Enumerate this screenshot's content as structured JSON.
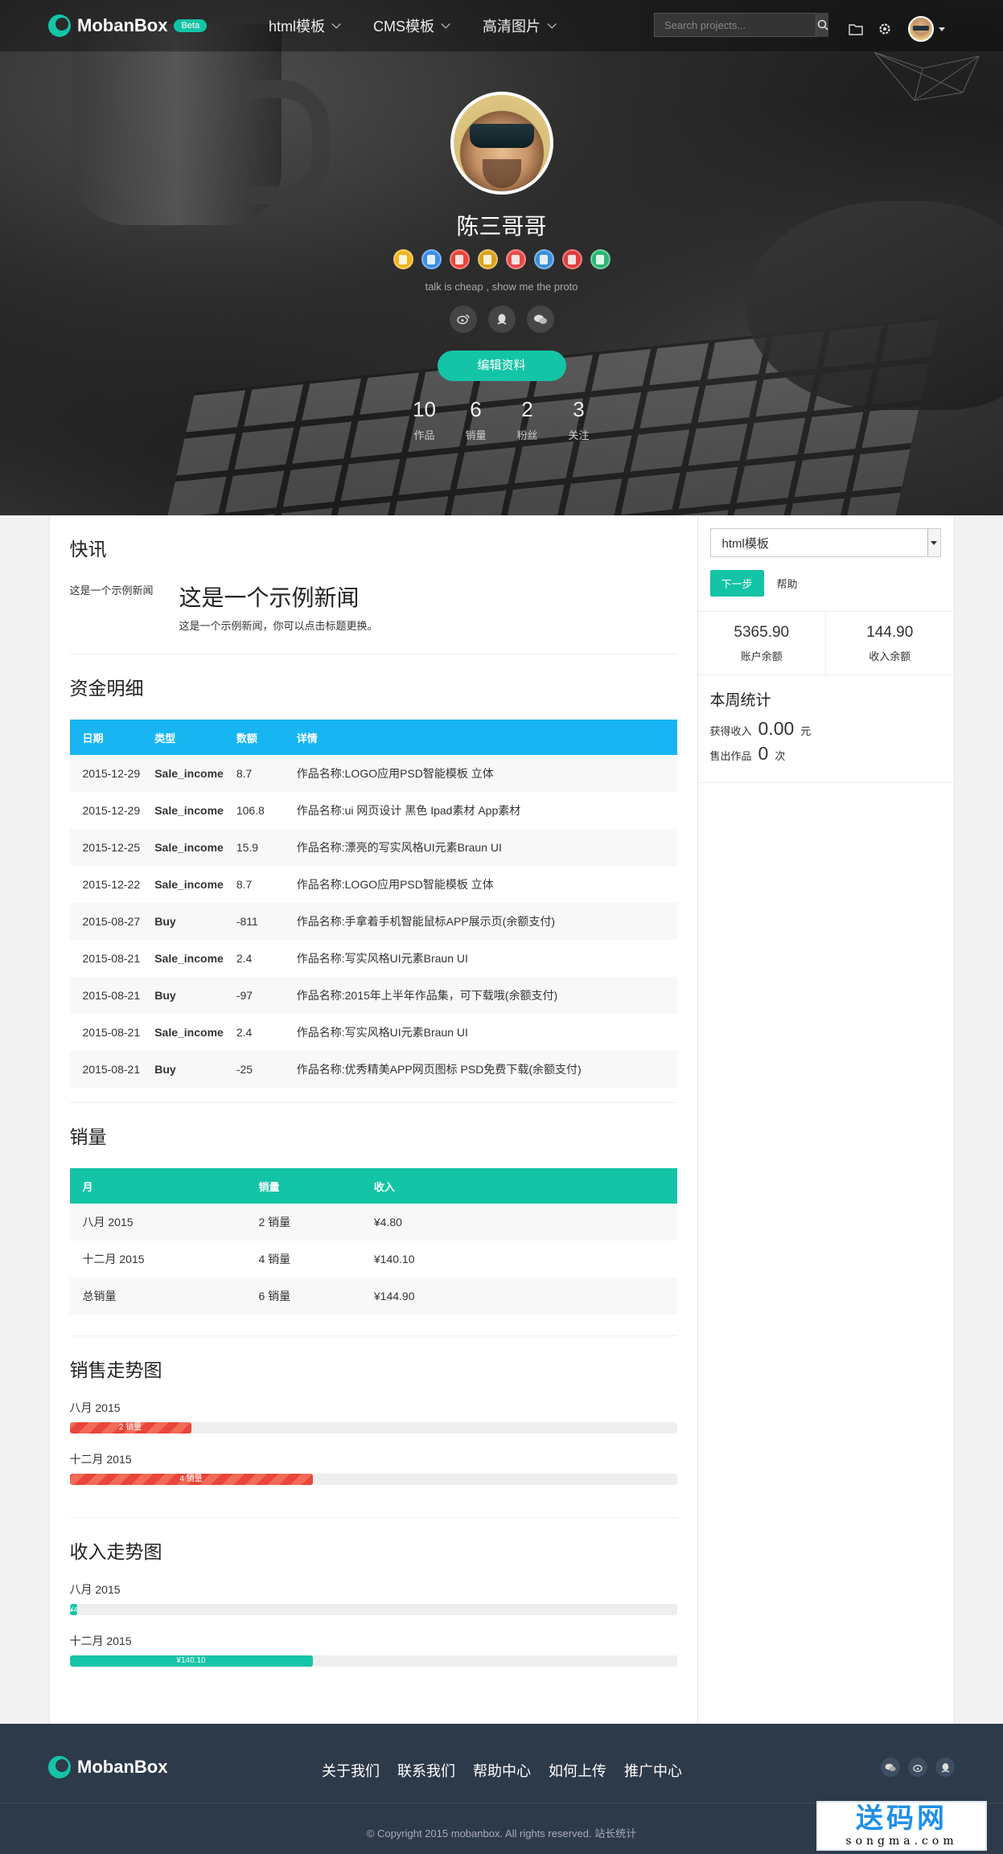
{
  "brand": {
    "name": "MobanBox",
    "beta": "Beta"
  },
  "nav": [
    {
      "label": "html模板"
    },
    {
      "label": "CMS模板"
    },
    {
      "label": "高清图片"
    }
  ],
  "search": {
    "placeholder": "Search projects..."
  },
  "profile": {
    "name": "陈三哥哥",
    "motto": "talk is cheap , show me the proto",
    "edit_label": "编辑资料",
    "badges": [
      {
        "icon": "badge-yellow-doc",
        "color": "#f2b51c"
      },
      {
        "icon": "badge-blue-doc",
        "color": "#3b8ee8"
      },
      {
        "icon": "badge-red-doc",
        "color": "#e8453a"
      },
      {
        "icon": "badge-gold-ticket",
        "color": "#d9a21a"
      },
      {
        "icon": "badge-lifebuoy",
        "color": "#e84a4a"
      },
      {
        "icon": "badge-blue-shield",
        "color": "#3a8fd9"
      },
      {
        "icon": "badge-red-gear",
        "color": "#e23c3c"
      },
      {
        "icon": "badge-green-list",
        "color": "#2bb673"
      }
    ],
    "stats": [
      {
        "value": "10",
        "label": "作品"
      },
      {
        "value": "6",
        "label": "销量"
      },
      {
        "value": "2",
        "label": "粉丝"
      },
      {
        "value": "3",
        "label": "关注"
      }
    ]
  },
  "news": {
    "heading": "快讯",
    "tag": "这是一个示例新闻",
    "title": "这是一个示例新闻",
    "desc": "这是一个示例新闻，你可以点击标题更换。"
  },
  "funds": {
    "heading": "资金明细",
    "columns": [
      "日期",
      "类型",
      "数额",
      "详情"
    ],
    "rows": [
      [
        "2015-12-29",
        "Sale_income",
        "8.7",
        "作品名称:LOGO应用PSD智能模板 立体"
      ],
      [
        "2015-12-29",
        "Sale_income",
        "106.8",
        "作品名称:ui 网页设计 黑色 Ipad素材 App素材"
      ],
      [
        "2015-12-25",
        "Sale_income",
        "15.9",
        "作品名称:漂亮的写实风格UI元素Braun UI"
      ],
      [
        "2015-12-22",
        "Sale_income",
        "8.7",
        "作品名称:LOGO应用PSD智能模板 立体"
      ],
      [
        "2015-08-27",
        "Buy",
        "-811",
        "作品名称:手拿着手机智能鼠标APP展示页(余额支付)"
      ],
      [
        "2015-08-21",
        "Sale_income",
        "2.4",
        "作品名称:写实风格UI元素Braun UI"
      ],
      [
        "2015-08-21",
        "Buy",
        "-97",
        "作品名称:2015年上半年作品集，可下载哦(余额支付)"
      ],
      [
        "2015-08-21",
        "Sale_income",
        "2.4",
        "作品名称:写实风格UI元素Braun UI"
      ],
      [
        "2015-08-21",
        "Buy",
        "-25",
        "作品名称:优秀精美APP网页图标 PSD免费下载(余额支付)"
      ]
    ]
  },
  "sales": {
    "heading": "销量",
    "columns": [
      "月",
      "销量",
      "收入"
    ],
    "rows": [
      [
        "八月 2015",
        "2 销量",
        "¥4.80"
      ],
      [
        "十二月 2015",
        "4 销量",
        "¥140.10"
      ],
      [
        "总销量",
        "6 销量",
        "¥144.90"
      ]
    ]
  },
  "sales_trend": {
    "heading": "销售走势图",
    "bars": [
      {
        "label": "八月 2015",
        "text": "2 销量",
        "percent": 20
      },
      {
        "label": "十二月 2015",
        "text": "4 销量",
        "percent": 40
      }
    ]
  },
  "income_trend": {
    "heading": "收入走势图",
    "bars": [
      {
        "label": "八月 2015",
        "text": "¥4.80",
        "percent": 1.3
      },
      {
        "label": "十二月 2015",
        "text": "¥140.10",
        "percent": 40
      }
    ]
  },
  "side": {
    "select_value": "html模板",
    "next_label": "下一步",
    "help_label": "帮助",
    "balances": [
      {
        "value": "5365.90",
        "label": "账户余额"
      },
      {
        "value": "144.90",
        "label": "收入余额"
      }
    ],
    "week": {
      "title": "本周统计",
      "income_label": "获得收入",
      "income_value": "0.00",
      "income_unit": "元",
      "sold_label": "售出作品",
      "sold_value": "0",
      "sold_unit": "次"
    }
  },
  "footer": {
    "links": [
      "关于我们",
      "联系我们",
      "帮助中心",
      "如何上传",
      "推广中心"
    ],
    "copyright": "© Copyright 2015 mobanbox. All rights reserved.   站长统计",
    "watermark_top": "送码网",
    "watermark_bottom": "songma.com"
  },
  "colors": {
    "accent": "#14c4a6",
    "table_blue": "#17b6f2",
    "bar_red": "#e9453a",
    "footer_bg": "#2d3a4a"
  }
}
